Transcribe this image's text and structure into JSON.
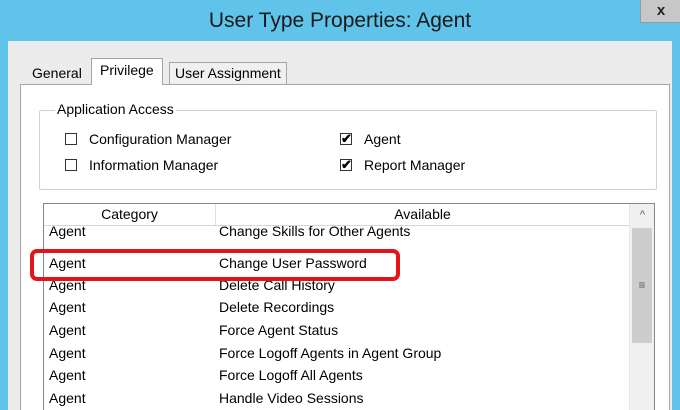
{
  "window": {
    "title": "User Type Properties: Agent",
    "close_label": "x"
  },
  "tabs": [
    {
      "label": "General"
    },
    {
      "label": "Privilege"
    },
    {
      "label": "User Assignment"
    }
  ],
  "application_access": {
    "legend": "Application Access",
    "checkboxes": [
      {
        "label": "Configuration Manager",
        "checked": false
      },
      {
        "label": "Information Manager",
        "checked": false
      },
      {
        "label": "Agent",
        "checked": true
      },
      {
        "label": "Report Manager",
        "checked": true
      }
    ]
  },
  "privileges_list": {
    "columns": [
      "Category",
      "Available"
    ],
    "rows": [
      {
        "category": "Agent",
        "available": "Change Skills for Other Agents"
      },
      {
        "category": "Agent",
        "available": "Change User Password",
        "highlighted": true
      },
      {
        "category": "Agent",
        "available": "Delete Call History"
      },
      {
        "category": "Agent",
        "available": "Delete Recordings"
      },
      {
        "category": "Agent",
        "available": "Force Agent Status"
      },
      {
        "category": "Agent",
        "available": "Force Logoff Agents in Agent Group"
      },
      {
        "category": "Agent",
        "available": "Force Logoff All Agents"
      },
      {
        "category": "Agent",
        "available": "Handle Video Sessions"
      }
    ],
    "scroll_up_glyph": "^",
    "scroll_thumb_grip": "≡"
  },
  "colors": {
    "titlebar": "#5fc3ea",
    "highlight": "#e3151a"
  },
  "checked_mark": "✔"
}
